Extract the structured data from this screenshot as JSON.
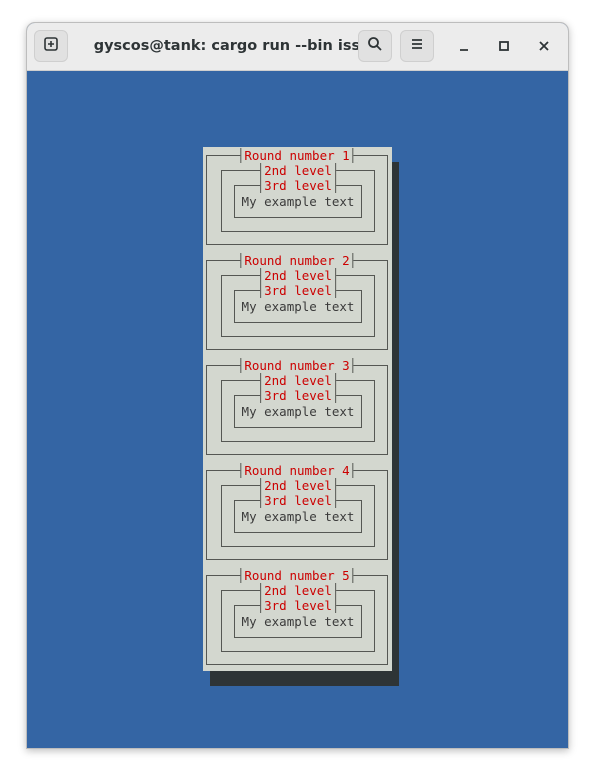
{
  "window": {
    "title": "gyscos@tank: cargo run --bin issue",
    "buttons": {
      "new_tab": "new-tab-icon",
      "search": "search-icon",
      "menu": "hamburger-menu-icon",
      "minimize": "minimize-icon",
      "maximize": "maximize-icon",
      "close": "close-icon"
    }
  },
  "terminal": {
    "background": "#3465a4",
    "panels": [
      {
        "title": "Round number 1",
        "level2": "2nd level",
        "level3": "3rd level",
        "text": "My example text"
      },
      {
        "title": "Round number 2",
        "level2": "2nd level",
        "level3": "3rd level",
        "text": "My example text"
      },
      {
        "title": "Round number 3",
        "level2": "2nd level",
        "level3": "3rd level",
        "text": "My example text"
      },
      {
        "title": "Round number 4",
        "level2": "2nd level",
        "level3": "3rd level",
        "text": "My example text"
      },
      {
        "title": "Round number 5",
        "level2": "2nd level",
        "level3": "3rd level",
        "text": "My example text"
      }
    ]
  },
  "colors": {
    "title_red": "#cc0000",
    "panel_bg": "#d3d7cf",
    "shadow": "#2e3436"
  }
}
